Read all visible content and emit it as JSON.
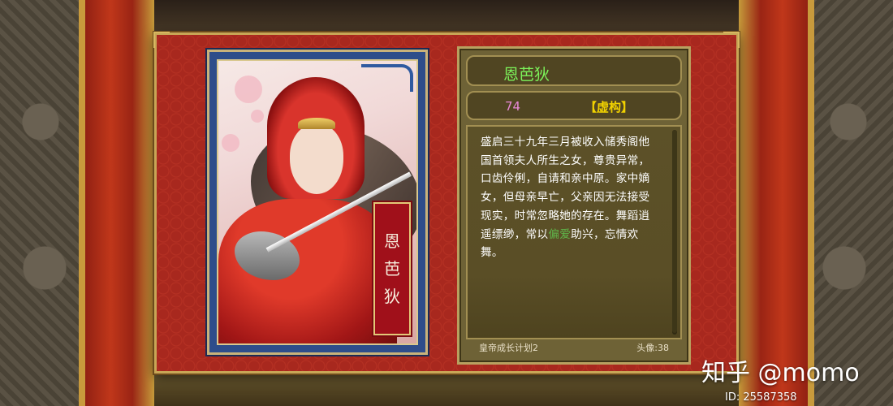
{
  "card": {
    "name_chars": [
      "恩",
      "芭",
      "狄"
    ]
  },
  "info": {
    "name": "恩芭狄",
    "value": "74",
    "tag": "【虚构】",
    "description_before": "盛启三十九年三月被收入储秀阁他国首领夫人所生之女，尊贵异常，口齿伶俐，自请和亲中原。家中嫡女，但母亲早亡，父亲因无法接受现实，时常忽略她的存在。舞蹈逍遥缥缈，常以",
    "description_highlight": "偏爱",
    "description_after": "助兴，忘情欢舞。",
    "footer_left": "皇帝成长计划2",
    "footer_right": "头像:38"
  },
  "watermark": {
    "text": "知乎 @momo",
    "id": "ID: 25587358"
  },
  "colors": {
    "name": "#7cf25a",
    "value": "#e889d8",
    "tag": "#f2d200",
    "highlight": "#5fb54a",
    "dialog_bg": "#a8281e",
    "panel_bg": "#6e6236"
  }
}
